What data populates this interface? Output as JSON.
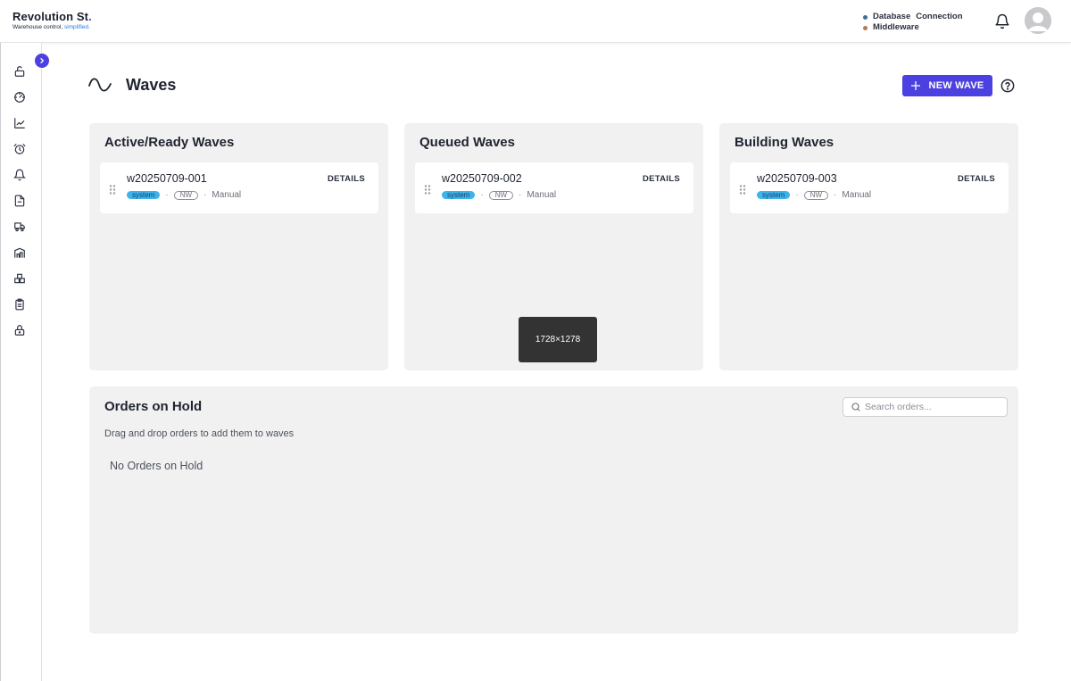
{
  "brand": {
    "name": "Revolution St",
    "name_dot": ".",
    "tagline_prefix": "Warehouse control, ",
    "tagline_highlight": "simplified."
  },
  "status": {
    "items": [
      {
        "label": "Database",
        "label2": "Connection",
        "color": "#3a6f9a"
      },
      {
        "label": "Middleware",
        "label2": "",
        "color": "#b07a5a"
      }
    ]
  },
  "sidebar": {
    "icons": [
      "lock-open-icon",
      "dashboard-gauge-icon",
      "chart-trend-icon",
      "alarm-clock-icon",
      "bell-icon",
      "document-icon",
      "truck-icon",
      "warehouse-icon",
      "boxes-icon",
      "clipboard-icon",
      "lock-icon"
    ]
  },
  "page": {
    "title": "Waves",
    "new_wave_label": "NEW WAVE"
  },
  "panels": [
    {
      "title": "Active/Ready Waves",
      "card": {
        "id": "w20250709-001",
        "details": "DETAILS",
        "source": "system",
        "type": "NW",
        "mode": "Manual"
      }
    },
    {
      "title": "Queued Waves",
      "card": {
        "id": "w20250709-002",
        "details": "DETAILS",
        "source": "system",
        "type": "NW",
        "mode": "Manual"
      }
    },
    {
      "title": "Building Waves",
      "card": {
        "id": "w20250709-003",
        "details": "DETAILS",
        "source": "system",
        "type": "NW",
        "mode": "Manual"
      }
    }
  ],
  "tooltip": {
    "text": "1728×1278"
  },
  "orders": {
    "title": "Orders on Hold",
    "subtitle": "Drag and drop orders to add them to waves",
    "empty": "No Orders on Hold",
    "search_placeholder": "Search orders..."
  },
  "colors": {
    "accent": "#4b40e0",
    "panel_bg": "#f1f1f1",
    "pill_system": "#3db3ec"
  }
}
